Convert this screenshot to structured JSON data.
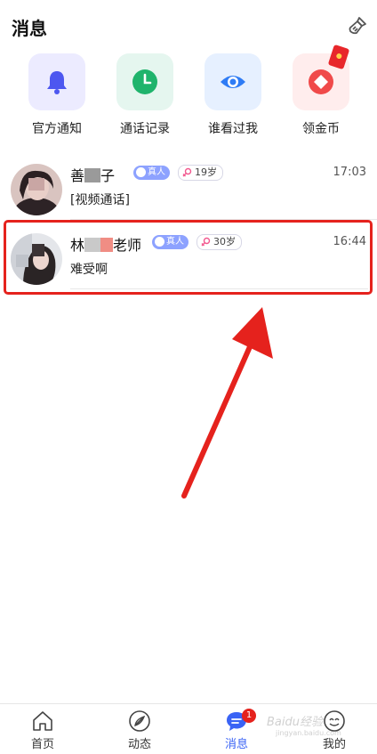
{
  "header": {
    "title": "消息",
    "clear_icon": "broom-icon"
  },
  "quick_actions": [
    {
      "label": "官方通知",
      "icon": "bell-icon",
      "bg": "#ecebff",
      "color": "#4d57f0"
    },
    {
      "label": "通话记录",
      "icon": "clock-icon",
      "bg": "#e5f6ef",
      "color": "#1fb46c"
    },
    {
      "label": "谁看过我",
      "icon": "eye-icon",
      "bg": "#e6f0ff",
      "color": "#2f7cf5"
    },
    {
      "label": "领金币",
      "icon": "coin-icon",
      "bg": "#ffeded",
      "color": "#f04a4a"
    }
  ],
  "conversations": [
    {
      "name_part1": "善",
      "name_part2": "子",
      "verified": "真人",
      "age": "19岁",
      "time": "17:03",
      "preview": "[视频通话]"
    },
    {
      "name_part1": "林",
      "name_part2": "老师",
      "verified": "真人",
      "age": "30岁",
      "time": "16:44",
      "preview": "难受啊"
    }
  ],
  "tabs": [
    {
      "label": "首页",
      "icon": "home-icon"
    },
    {
      "label": "动态",
      "icon": "compass-icon"
    },
    {
      "label": "消息",
      "icon": "chat-icon",
      "badge": "1"
    },
    {
      "label": "我的",
      "icon": "profile-icon"
    }
  ],
  "watermark": {
    "line1": "Baidu经验",
    "line2": "jingyan.baidu.com"
  },
  "colors": {
    "accent": "#3a63f5",
    "annotation_red": "#e5221d"
  }
}
